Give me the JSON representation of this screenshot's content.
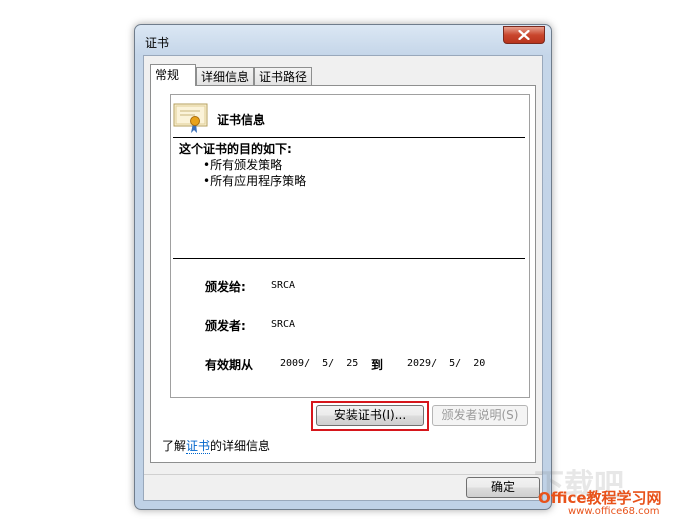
{
  "window": {
    "title": "证书"
  },
  "tabs": [
    {
      "label": "常规"
    },
    {
      "label": "详细信息"
    },
    {
      "label": "证书路径"
    }
  ],
  "certificate": {
    "heading": "证书信息",
    "purpose_title": "这个证书的目的如下:",
    "purposes": [
      "•所有颁发策略",
      "•所有应用程序策略"
    ],
    "issued_to_label": "颁发给:",
    "issued_to_value": "SRCA",
    "issued_by_label": "颁发者:",
    "issued_by_value": "SRCA",
    "validity_label": "有效期从",
    "valid_from": "2009/  5/  25",
    "to_word": "到",
    "valid_to": "2029/  5/  20"
  },
  "buttons": {
    "install": "安装证书(I)...",
    "issuer_statement": "颁发者说明(S)",
    "ok": "确定"
  },
  "learn_more": {
    "prefix": "了解",
    "link": "证书",
    "suffix": "的详细信息"
  },
  "watermark": {
    "ghost": "下载吧",
    "brand": "Office教程学习网",
    "url": "www.office68.com"
  },
  "colors": {
    "highlight": "#d6161b",
    "link": "#0066cc",
    "close_button": "#c9462d",
    "watermark": "#e8521a"
  },
  "icons": {
    "close": "close-icon",
    "certificate": "certificate-icon"
  }
}
